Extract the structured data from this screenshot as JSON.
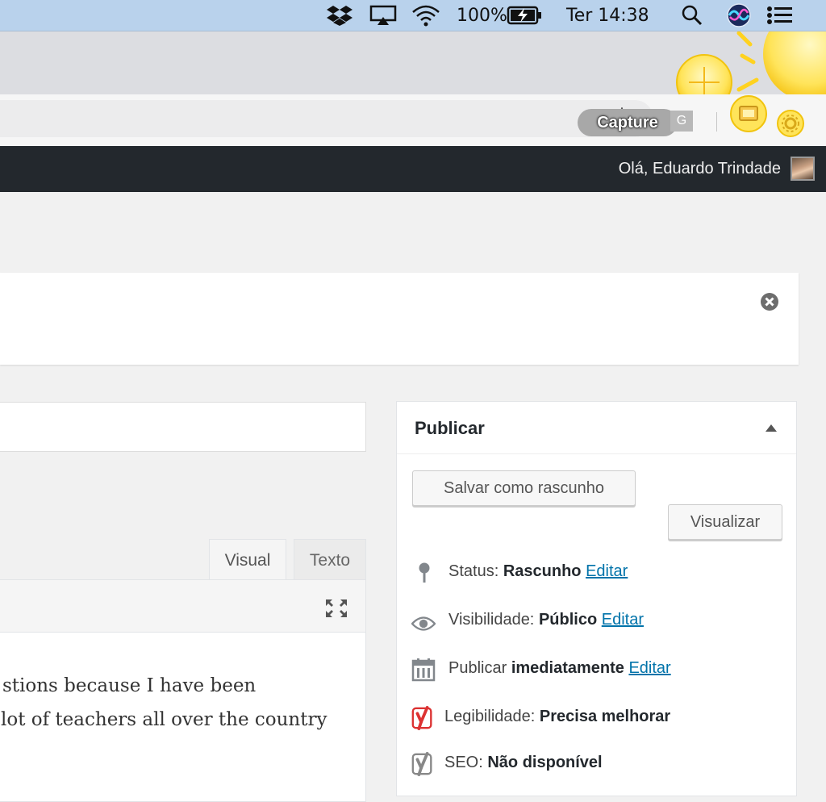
{
  "menubar": {
    "battery": "100%",
    "clock": "Ter 14:38"
  },
  "browser": {
    "capture_label": "Capture",
    "g_badge": "G"
  },
  "adminbar": {
    "greeting": "Olá, Eduardo Trindade"
  },
  "editor": {
    "tab_visual": "Visual",
    "tab_text": "Texto",
    "lines": [
      "stions because I have been",
      " lot of teachers all over the country"
    ]
  },
  "publish": {
    "title": "Publicar",
    "save_draft": "Salvar como rascunho",
    "preview": "Visualizar",
    "status_label": "Status:",
    "status_value": "Rascunho",
    "visibility_label": "Visibilidade:",
    "visibility_value": "Público",
    "schedule_label": "Publicar",
    "schedule_value": "imediatamente",
    "edit": "Editar",
    "readability_label": "Legibilidade:",
    "readability_value": "Precisa melhorar",
    "seo_label": "SEO:",
    "seo_value": "Não disponível"
  },
  "colors": {
    "adminbar_bg": "#23282d",
    "link": "#0073aa",
    "yoast_bad": "#dc3232",
    "yoast_na": "#888888"
  }
}
